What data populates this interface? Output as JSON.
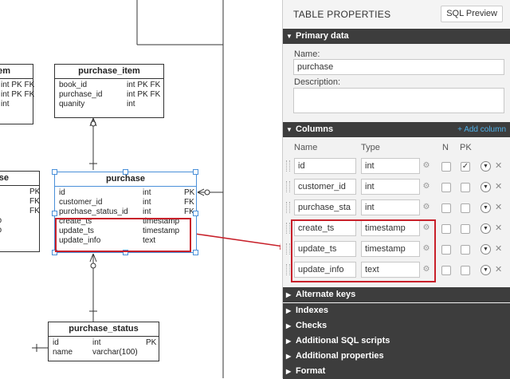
{
  "diagram": {
    "purchase_item": {
      "title": "purchase_item",
      "rows": [
        {
          "name": "book_id",
          "type": "int PK FK"
        },
        {
          "name": "purchase_id",
          "type": "int PK FK"
        },
        {
          "name": "quanity",
          "type": "int"
        }
      ]
    },
    "item_partial": {
      "title": "item",
      "rows": [
        {
          "type": "int PK FK"
        },
        {
          "type": "int PK FK"
        },
        {
          "type": "int"
        }
      ]
    },
    "purchase_partial": {
      "title": "se",
      "rows": [
        {
          "key": "PK"
        },
        {
          "key": "FK"
        },
        {
          "key": "FK"
        },
        {
          "type": "timestamp"
        },
        {
          "type": "timestamp"
        }
      ]
    },
    "purchase": {
      "title": "purchase",
      "rows": [
        {
          "name": "id",
          "type": "int",
          "key": "PK"
        },
        {
          "name": "customer_id",
          "type": "int",
          "key": "FK"
        },
        {
          "name": "purchase_status_id",
          "type": "int",
          "key": "FK"
        },
        {
          "name": "create_ts",
          "type": "timestamp",
          "key": ""
        },
        {
          "name": "update_ts",
          "type": "timestamp",
          "key": ""
        },
        {
          "name": "update_info",
          "type": "text",
          "key": ""
        }
      ]
    },
    "purchase_status": {
      "title": "purchase_status",
      "rows": [
        {
          "name": "id",
          "type": "int",
          "key": "PK"
        },
        {
          "name": "name",
          "type": "varchar(100)",
          "key": ""
        }
      ]
    }
  },
  "panel": {
    "title": "TABLE PROPERTIES",
    "sql_preview": "SQL Preview",
    "primary": {
      "header": "Primary data",
      "name_label": "Name:",
      "name_value": "purchase",
      "desc_label": "Description:",
      "desc_value": ""
    },
    "columns": {
      "header": "Columns",
      "add": "+ Add column",
      "h_name": "Name",
      "h_type": "Type",
      "h_n": "N",
      "h_pk": "PK",
      "rows": [
        {
          "name": "id",
          "type": "int",
          "nullable": false,
          "pk": true
        },
        {
          "name": "customer_id",
          "type": "int",
          "nullable": false,
          "pk": false
        },
        {
          "name": "purchase_sta",
          "type": "int",
          "nullable": false,
          "pk": false
        },
        {
          "name": "create_ts",
          "type": "timestamp",
          "nullable": false,
          "pk": false
        },
        {
          "name": "update_ts",
          "type": "timestamp",
          "nullable": false,
          "pk": false
        },
        {
          "name": "update_info",
          "type": "text",
          "nullable": false,
          "pk": false
        }
      ]
    },
    "sections": [
      "Alternate keys",
      "Indexes",
      "Checks",
      "Additional SQL scripts",
      "Additional properties",
      "Format"
    ]
  },
  "colors": {
    "highlight": "#c8202a",
    "selection": "#4a90d9",
    "bar": "#3d3d3d",
    "link": "#4fb0e8"
  },
  "icons": [
    "gear-icon",
    "radio-toggle-icon",
    "delete-icon",
    "drag-handle-icon",
    "triangle-down-icon",
    "triangle-right-icon"
  ]
}
